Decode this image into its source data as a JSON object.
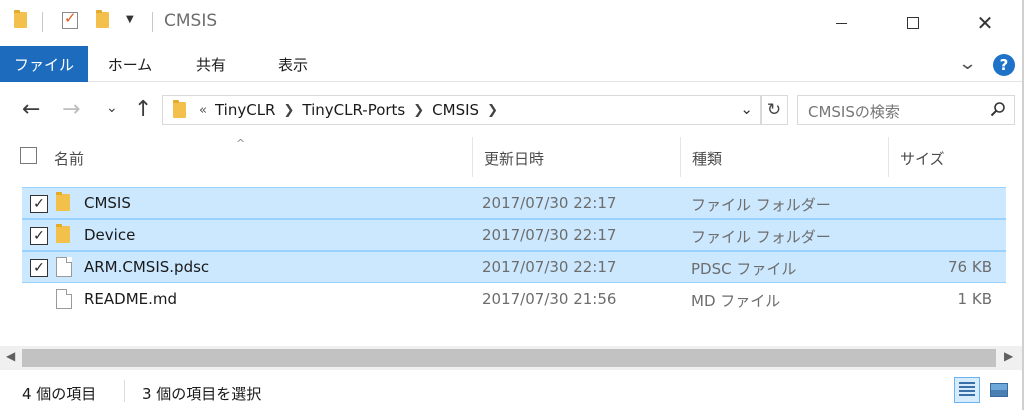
{
  "window": {
    "title": "CMSIS",
    "minimize_icon": "minimize-icon",
    "maximize_icon": "maximize-icon",
    "close_icon": "close-icon"
  },
  "ribbon": {
    "tabs": [
      {
        "label": "ファイル",
        "active": true
      },
      {
        "label": "ホーム"
      },
      {
        "label": "共有"
      },
      {
        "label": "表示"
      }
    ],
    "help": "?",
    "accent": "#1c6bbd"
  },
  "address": {
    "overflow": "«",
    "crumbs": [
      "TinyCLR",
      "TinyCLR-Ports",
      "CMSIS"
    ],
    "search_placeholder": "CMSISの検索"
  },
  "columns": {
    "name": "名前",
    "date": "更新日時",
    "type": "種類",
    "size": "サイズ"
  },
  "files": [
    {
      "name": "CMSIS",
      "date": "2017/07/30 22:17",
      "type": "ファイル フォルダー",
      "size": "",
      "icon": "folder-icon",
      "selected": true
    },
    {
      "name": "Device",
      "date": "2017/07/30 22:17",
      "type": "ファイル フォルダー",
      "size": "",
      "icon": "folder-icon",
      "selected": true
    },
    {
      "name": "ARM.CMSIS.pdsc",
      "date": "2017/07/30 22:17",
      "type": "PDSC ファイル",
      "size": "76 KB",
      "icon": "file-icon",
      "selected": true
    },
    {
      "name": "README.md",
      "date": "2017/07/30 21:56",
      "type": "MD ファイル",
      "size": "1 KB",
      "icon": "file-icon",
      "selected": false
    }
  ],
  "status": {
    "count": "4 個の項目",
    "selection": "3 個の項目を選択"
  },
  "colors": {
    "selection_bg": "#cce8ff",
    "selection_border": "#99d1ff",
    "folder": "#f3c04c"
  }
}
